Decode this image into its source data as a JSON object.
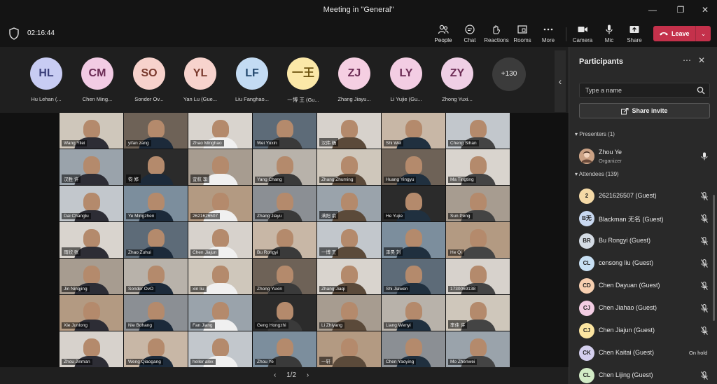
{
  "window": {
    "title": "Meeting in \"General\""
  },
  "toolbar": {
    "timer": "02:16:44",
    "buttons": [
      {
        "label": "People",
        "icon": "people-icon"
      },
      {
        "label": "Chat",
        "icon": "chat-icon"
      },
      {
        "label": "Reactions",
        "icon": "reactions-icon"
      },
      {
        "label": "Rooms",
        "icon": "rooms-icon"
      },
      {
        "label": "More",
        "icon": "more-icon"
      },
      {
        "label": "Camera",
        "icon": "camera-icon"
      },
      {
        "label": "Mic",
        "icon": "mic-icon"
      },
      {
        "label": "Share",
        "icon": "share-icon"
      }
    ],
    "leave_label": "Leave"
  },
  "top_avatars": [
    {
      "initials": "HL",
      "name": "Hu Lehan (...",
      "bg": "#c8ccf3",
      "fg": "#3b3f7a"
    },
    {
      "initials": "CM",
      "name": "Chen Ming...",
      "bg": "#f2cbe4",
      "fg": "#6b2b54"
    },
    {
      "initials": "SO",
      "name": "Sonder Ov...",
      "bg": "#f7d2cc",
      "fg": "#7a3a2e"
    },
    {
      "initials": "YL",
      "name": "Yan Lu (Gue...",
      "bg": "#f7d3cd",
      "fg": "#7a3a2e"
    },
    {
      "initials": "LF",
      "name": "Liu Fanghao...",
      "bg": "#c3dbf3",
      "fg": "#23486e"
    },
    {
      "initials": "一王",
      "name": "一博 王 (Gu...",
      "bg": "#fbe8a8",
      "fg": "#6e5410"
    },
    {
      "initials": "ZJ",
      "name": "Zhang Jiayu...",
      "bg": "#f5cfe2",
      "fg": "#6b2b54"
    },
    {
      "initials": "LY",
      "name": "Li Yujie (Gu...",
      "bg": "#f3cde3",
      "fg": "#6b2b54"
    },
    {
      "initials": "ZY",
      "name": "Zhong Yuxi...",
      "bg": "#efcfe5",
      "fg": "#6b2b54"
    }
  ],
  "overflow_count": "+130",
  "grid_tiles": [
    "Wang Yilei",
    "yifan zang",
    "Zhao Minghao",
    "Wei Yuxin",
    "汉炜 杨",
    "Shi Wei",
    "Cheng Sihan",
    "汉胜 许",
    "钧 郑",
    "宜航 李",
    "Yang Chang",
    "Zhang Zhuming",
    "Huang Yingyu",
    "Ma Tingting",
    "Dai Changlu",
    "Ye Mingzhen",
    "2621626507",
    "Zhang Jiayu",
    "满阳 俞",
    "He Yujie",
    "Sun Peng",
    "雨欣 张",
    "Zhao Zuhui",
    "Chen Jiajun",
    "Bu Rongyi",
    "一博 王",
    "泽昊 刘",
    "He Qi",
    "Jin Ningjing",
    "Sonder OvO",
    "xin liu",
    "Zhong Yuxin",
    "Zhang Jiaqi",
    "Shi Jiawen",
    "1730069138",
    "Xie Junlong",
    "Nie Bohang",
    "Fan Jiang",
    "Geng Hongzhi",
    "Li Zhiyang",
    "Liang Wenyi",
    "率佳 许",
    "Zhou Jinman",
    "Weng Qiaogang",
    "heller alex",
    "Zhou Ye",
    "一轩",
    "Chen Yaoying",
    "Mo Zhenwei"
  ],
  "pager": {
    "prev": "‹",
    "label": "1/2",
    "next": "›"
  },
  "panel": {
    "title": "Participants",
    "search_placeholder": "Type a name",
    "invite_label": "Share invite",
    "presenters_label": "Presenters (1)",
    "attendees_label": "Attendees (139)",
    "presenter": {
      "name": "Zhou Ye",
      "role": "Organizer"
    },
    "attendees": [
      {
        "initials": "2",
        "name": "2621626507 (Guest)",
        "bg": "#f4d9a6",
        "status": ""
      },
      {
        "initials": "B无",
        "name": "Blackman 无名 (Guest)",
        "bg": "#c8d8f0",
        "status": ""
      },
      {
        "initials": "BR",
        "name": "Bu Rongyi (Guest)",
        "bg": "#d4dbe4",
        "status": ""
      },
      {
        "initials": "CL",
        "name": "censong liu (Guest)",
        "bg": "#c8e0f4",
        "status": ""
      },
      {
        "initials": "CD",
        "name": "Chen Dayuan (Guest)",
        "bg": "#f7cfb0",
        "status": ""
      },
      {
        "initials": "CJ",
        "name": "Chen Jiahao (Guest)",
        "bg": "#f3cde3",
        "status": ""
      },
      {
        "initials": "CJ",
        "name": "Chen Jiajun (Guest)",
        "bg": "#fbe4a0",
        "status": ""
      },
      {
        "initials": "CK",
        "name": "Chen Kaitai (Guest)",
        "bg": "#d4cfee",
        "status": "On hold"
      },
      {
        "initials": "CL",
        "name": "Chen Lijing (Guest)",
        "bg": "#d2ebc6",
        "status": ""
      }
    ]
  }
}
